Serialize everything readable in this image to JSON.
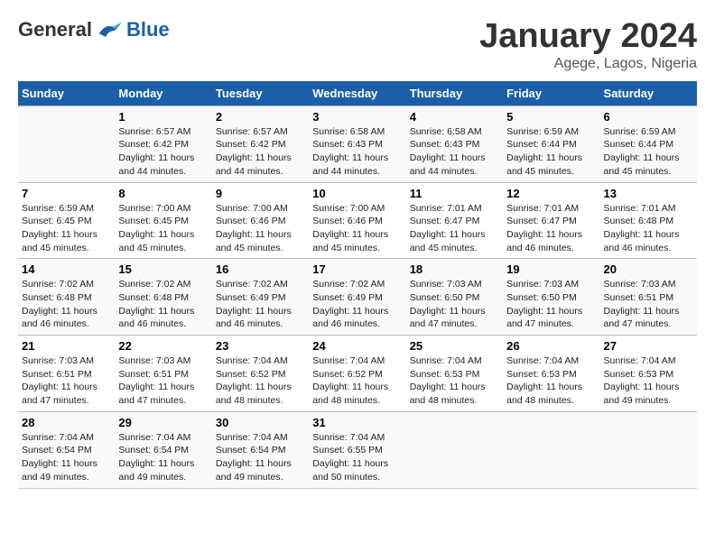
{
  "logo": {
    "general": "General",
    "blue": "Blue"
  },
  "title": {
    "month": "January 2024",
    "location": "Agege, Lagos, Nigeria"
  },
  "headers": [
    "Sunday",
    "Monday",
    "Tuesday",
    "Wednesday",
    "Thursday",
    "Friday",
    "Saturday"
  ],
  "weeks": [
    [
      {
        "num": "",
        "sunrise": "",
        "sunset": "",
        "daylight": ""
      },
      {
        "num": "1",
        "sunrise": "Sunrise: 6:57 AM",
        "sunset": "Sunset: 6:42 PM",
        "daylight": "Daylight: 11 hours and 44 minutes."
      },
      {
        "num": "2",
        "sunrise": "Sunrise: 6:57 AM",
        "sunset": "Sunset: 6:42 PM",
        "daylight": "Daylight: 11 hours and 44 minutes."
      },
      {
        "num": "3",
        "sunrise": "Sunrise: 6:58 AM",
        "sunset": "Sunset: 6:43 PM",
        "daylight": "Daylight: 11 hours and 44 minutes."
      },
      {
        "num": "4",
        "sunrise": "Sunrise: 6:58 AM",
        "sunset": "Sunset: 6:43 PM",
        "daylight": "Daylight: 11 hours and 44 minutes."
      },
      {
        "num": "5",
        "sunrise": "Sunrise: 6:59 AM",
        "sunset": "Sunset: 6:44 PM",
        "daylight": "Daylight: 11 hours and 45 minutes."
      },
      {
        "num": "6",
        "sunrise": "Sunrise: 6:59 AM",
        "sunset": "Sunset: 6:44 PM",
        "daylight": "Daylight: 11 hours and 45 minutes."
      }
    ],
    [
      {
        "num": "7",
        "sunrise": "Sunrise: 6:59 AM",
        "sunset": "Sunset: 6:45 PM",
        "daylight": "Daylight: 11 hours and 45 minutes."
      },
      {
        "num": "8",
        "sunrise": "Sunrise: 7:00 AM",
        "sunset": "Sunset: 6:45 PM",
        "daylight": "Daylight: 11 hours and 45 minutes."
      },
      {
        "num": "9",
        "sunrise": "Sunrise: 7:00 AM",
        "sunset": "Sunset: 6:46 PM",
        "daylight": "Daylight: 11 hours and 45 minutes."
      },
      {
        "num": "10",
        "sunrise": "Sunrise: 7:00 AM",
        "sunset": "Sunset: 6:46 PM",
        "daylight": "Daylight: 11 hours and 45 minutes."
      },
      {
        "num": "11",
        "sunrise": "Sunrise: 7:01 AM",
        "sunset": "Sunset: 6:47 PM",
        "daylight": "Daylight: 11 hours and 45 minutes."
      },
      {
        "num": "12",
        "sunrise": "Sunrise: 7:01 AM",
        "sunset": "Sunset: 6:47 PM",
        "daylight": "Daylight: 11 hours and 46 minutes."
      },
      {
        "num": "13",
        "sunrise": "Sunrise: 7:01 AM",
        "sunset": "Sunset: 6:48 PM",
        "daylight": "Daylight: 11 hours and 46 minutes."
      }
    ],
    [
      {
        "num": "14",
        "sunrise": "Sunrise: 7:02 AM",
        "sunset": "Sunset: 6:48 PM",
        "daylight": "Daylight: 11 hours and 46 minutes."
      },
      {
        "num": "15",
        "sunrise": "Sunrise: 7:02 AM",
        "sunset": "Sunset: 6:48 PM",
        "daylight": "Daylight: 11 hours and 46 minutes."
      },
      {
        "num": "16",
        "sunrise": "Sunrise: 7:02 AM",
        "sunset": "Sunset: 6:49 PM",
        "daylight": "Daylight: 11 hours and 46 minutes."
      },
      {
        "num": "17",
        "sunrise": "Sunrise: 7:02 AM",
        "sunset": "Sunset: 6:49 PM",
        "daylight": "Daylight: 11 hours and 46 minutes."
      },
      {
        "num": "18",
        "sunrise": "Sunrise: 7:03 AM",
        "sunset": "Sunset: 6:50 PM",
        "daylight": "Daylight: 11 hours and 47 minutes."
      },
      {
        "num": "19",
        "sunrise": "Sunrise: 7:03 AM",
        "sunset": "Sunset: 6:50 PM",
        "daylight": "Daylight: 11 hours and 47 minutes."
      },
      {
        "num": "20",
        "sunrise": "Sunrise: 7:03 AM",
        "sunset": "Sunset: 6:51 PM",
        "daylight": "Daylight: 11 hours and 47 minutes."
      }
    ],
    [
      {
        "num": "21",
        "sunrise": "Sunrise: 7:03 AM",
        "sunset": "Sunset: 6:51 PM",
        "daylight": "Daylight: 11 hours and 47 minutes."
      },
      {
        "num": "22",
        "sunrise": "Sunrise: 7:03 AM",
        "sunset": "Sunset: 6:51 PM",
        "daylight": "Daylight: 11 hours and 47 minutes."
      },
      {
        "num": "23",
        "sunrise": "Sunrise: 7:04 AM",
        "sunset": "Sunset: 6:52 PM",
        "daylight": "Daylight: 11 hours and 48 minutes."
      },
      {
        "num": "24",
        "sunrise": "Sunrise: 7:04 AM",
        "sunset": "Sunset: 6:52 PM",
        "daylight": "Daylight: 11 hours and 48 minutes."
      },
      {
        "num": "25",
        "sunrise": "Sunrise: 7:04 AM",
        "sunset": "Sunset: 6:53 PM",
        "daylight": "Daylight: 11 hours and 48 minutes."
      },
      {
        "num": "26",
        "sunrise": "Sunrise: 7:04 AM",
        "sunset": "Sunset: 6:53 PM",
        "daylight": "Daylight: 11 hours and 48 minutes."
      },
      {
        "num": "27",
        "sunrise": "Sunrise: 7:04 AM",
        "sunset": "Sunset: 6:53 PM",
        "daylight": "Daylight: 11 hours and 49 minutes."
      }
    ],
    [
      {
        "num": "28",
        "sunrise": "Sunrise: 7:04 AM",
        "sunset": "Sunset: 6:54 PM",
        "daylight": "Daylight: 11 hours and 49 minutes."
      },
      {
        "num": "29",
        "sunrise": "Sunrise: 7:04 AM",
        "sunset": "Sunset: 6:54 PM",
        "daylight": "Daylight: 11 hours and 49 minutes."
      },
      {
        "num": "30",
        "sunrise": "Sunrise: 7:04 AM",
        "sunset": "Sunset: 6:54 PM",
        "daylight": "Daylight: 11 hours and 49 minutes."
      },
      {
        "num": "31",
        "sunrise": "Sunrise: 7:04 AM",
        "sunset": "Sunset: 6:55 PM",
        "daylight": "Daylight: 11 hours and 50 minutes."
      },
      {
        "num": "",
        "sunrise": "",
        "sunset": "",
        "daylight": ""
      },
      {
        "num": "",
        "sunrise": "",
        "sunset": "",
        "daylight": ""
      },
      {
        "num": "",
        "sunrise": "",
        "sunset": "",
        "daylight": ""
      }
    ]
  ]
}
